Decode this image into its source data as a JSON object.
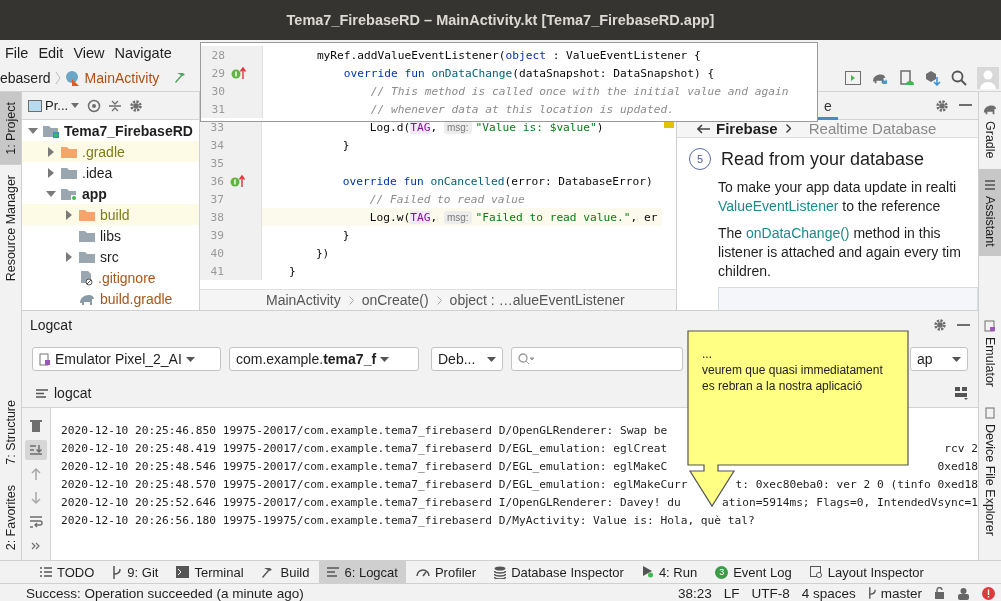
{
  "window": {
    "title": "Tema7_FirebaseRD – MainActivity.kt [Tema7_FirebaseRD.app]"
  },
  "menu": [
    "File",
    "Edit",
    "View",
    "Navigate"
  ],
  "navbar": {
    "crumbs": [
      "ebaserd",
      "MainActivity"
    ]
  },
  "left_strip": {
    "top": [
      {
        "label": "1: Project",
        "selected": true
      },
      {
        "label": "Resource Manager",
        "selected": false
      }
    ],
    "bottom": [
      {
        "label": "7: Structure",
        "selected": false
      },
      {
        "label": "2: Favorites",
        "selected": false
      }
    ]
  },
  "right_strip": {
    "top": [
      {
        "label": "Gradle",
        "kind": "gradle",
        "selected": false
      },
      {
        "label": "Assistant",
        "kind": "assistant",
        "selected": true
      }
    ],
    "bottom": [
      {
        "label": "Emulator",
        "kind": "emulator",
        "selected": false
      },
      {
        "label": "Device File Explorer",
        "kind": "device",
        "selected": false
      }
    ]
  },
  "project": {
    "title": "Pr...",
    "tree": [
      {
        "name": "Tema7_FirebaseRD",
        "kind": "module",
        "expanded": true,
        "children": [
          {
            "name": ".gradle",
            "kind": "folder",
            "excluded": true,
            "expanded": false
          },
          {
            "name": ".idea",
            "kind": "folder",
            "excluded": false,
            "expanded": false
          },
          {
            "name": "app",
            "kind": "module",
            "expanded": true,
            "children": [
              {
                "name": "build",
                "kind": "folder",
                "excluded": true,
                "expanded": false
              },
              {
                "name": "libs",
                "kind": "folder",
                "excluded": false
              },
              {
                "name": "src",
                "kind": "folder",
                "excluded": false,
                "expanded": false
              },
              {
                "name": ".gitignore",
                "kind": "file",
                "untracked": true
              },
              {
                "name": "build.gradle",
                "kind": "gradle",
                "untracked": true
              }
            ]
          }
        ]
      }
    ]
  },
  "editor": {
    "popup_lines": [
      {
        "number": "28",
        "marker": false,
        "current": false,
        "tokens": [
          {
            "kind": "p",
            "text": "        myRef.addValueEventListener("
          },
          {
            "kind": "kw",
            "text": "object"
          },
          {
            "kind": "p",
            "text": " : ValueEventListener {"
          }
        ]
      },
      {
        "number": "29",
        "marker": true,
        "current": false,
        "tokens": [
          {
            "kind": "kw",
            "text": "            override fun "
          },
          {
            "kind": "fn",
            "text": "onDataChange"
          },
          {
            "kind": "p",
            "text": "(dataSnapshot: DataSnapshot) {"
          }
        ]
      },
      {
        "number": "30",
        "marker": false,
        "current": false,
        "tokens": [
          {
            "kind": "cm",
            "text": "                // This method is called once with the initial value and again"
          }
        ]
      },
      {
        "number": "31",
        "marker": false,
        "current": false,
        "tokens": [
          {
            "kind": "cm",
            "text": "                // whenever data at this location is updated."
          }
        ]
      }
    ],
    "lines": [
      {
        "number": "33",
        "marker": false,
        "current": false,
        "tokens": [
          {
            "kind": "p",
            "text": "                Log.d("
          },
          {
            "kind": "tag",
            "text": "TAG"
          },
          {
            "kind": "p",
            "text": ", "
          },
          {
            "kind": "hint",
            "text": "msg:"
          },
          {
            "kind": "str",
            "text": "\"Value is: $value\""
          },
          {
            "kind": "p",
            "text": ")"
          }
        ]
      },
      {
        "number": "34",
        "marker": false,
        "current": false,
        "tokens": [
          {
            "kind": "p",
            "text": "            }"
          }
        ]
      },
      {
        "number": "35",
        "marker": false,
        "current": false
      },
      {
        "number": "36",
        "marker": true,
        "current": false,
        "tokens": [
          {
            "kind": "kw",
            "text": "            override fun "
          },
          {
            "kind": "fn",
            "text": "onCancelled"
          },
          {
            "kind": "p",
            "text": "(error: DatabaseError)"
          }
        ]
      },
      {
        "number": "37",
        "marker": false,
        "current": false,
        "tokens": [
          {
            "kind": "cm",
            "text": "                // Failed to read value"
          }
        ]
      },
      {
        "number": "38",
        "marker": false,
        "current": true,
        "tokens": [
          {
            "kind": "p",
            "text": "                Log.w("
          },
          {
            "kind": "tag",
            "text": "TAG"
          },
          {
            "kind": "p",
            "text": ", "
          },
          {
            "kind": "hint",
            "text": "msg:"
          },
          {
            "kind": "str",
            "text": "\"Failed to read value.\""
          },
          {
            "kind": "p",
            "text": ", er"
          }
        ]
      },
      {
        "number": "39",
        "marker": false,
        "current": false,
        "tokens": [
          {
            "kind": "p",
            "text": "            }"
          }
        ]
      },
      {
        "number": "40",
        "marker": false,
        "current": false,
        "tokens": [
          {
            "kind": "p",
            "text": "        })"
          }
        ]
      },
      {
        "number": "41",
        "marker": false,
        "current": false,
        "tokens": [
          {
            "kind": "p",
            "text": "    }"
          }
        ]
      }
    ],
    "breadcrumb": [
      "MainActivity",
      "onCreate()",
      "object : …alueEventListener"
    ]
  },
  "assistant": {
    "tab": "e",
    "back": "Firebase",
    "current": "Realtime Database",
    "step": "5",
    "heading": "Read from your database",
    "paragraphs": [
      [
        [
          {
            "kind": "plain",
            "text": "To make your app data update in realti"
          }
        ],
        [
          {
            "kind": "link",
            "text": "ValueEventListener"
          },
          {
            "kind": "plain",
            "text": " to the reference"
          }
        ]
      ],
      [
        [
          {
            "kind": "plain",
            "text": "The "
          },
          {
            "kind": "link",
            "text": "onDataChange()"
          },
          {
            "kind": "plain",
            "text": " method in this"
          }
        ],
        [
          {
            "kind": "plain",
            "text": "listener is attached and again every tim"
          }
        ],
        [
          {
            "kind": "plain",
            "text": "children."
          }
        ]
      ]
    ]
  },
  "logcat": {
    "title": "Logcat",
    "device": "Emulator Pixel_2_AI",
    "package": "com.example.**tema7_f**",
    "level": "Deb...",
    "filter": "ap",
    "tab": "logcat",
    "tools": [
      {
        "kind": "clear",
        "selected": false
      },
      {
        "kind": "scroll",
        "selected": true
      },
      {
        "kind": "up",
        "selected": false
      },
      {
        "kind": "down",
        "selected": false
      },
      {
        "kind": "wrap",
        "selected": false
      },
      {
        "kind": "more",
        "selected": false
      }
    ],
    "lines": [
      {
        "left": "2020-12-10 20:25:46.850 19975-20017/com.example.tema7_firebaserd D/OpenGLRenderer: Swap be"
      },
      {
        "left": "2020-12-10 20:25:48.419 19975-20017/com.example.tema7_firebaserd D/EGL_emulation: eglCreat",
        "right": "rcv 2"
      },
      {
        "left": "2020-12-10 20:25:48.546 19975-20017/com.example.tema7_firebaserd D/EGL_emulation: eglMakeC",
        "right": "0xed18"
      },
      {
        "left": "2020-12-10 20:25:48.570 19975-20017/com.example.tema7_firebaserd D/EGL_emulation: eglMakeCurr",
        "right": "t: 0xec80eba0: ver 2 0 (tinfo 0xed18"
      },
      {
        "left": "2020-12-10 20:25:52.646 19975-20017/com.example.tema7_firebaserd I/OpenGLRenderer: Davey! du",
        "right": "ation=5914ms; Flags=0, IntendedVsync=1"
      },
      {
        "left": "2020-12-10 20:26:56.180 19975-19975/com.example.tema7_firebaserd D/MyActivity: Value is: Hola, què tal?"
      }
    ]
  },
  "callout": {
    "lines": [
      "...",
      "veurem que quasi immediatament",
      "es rebran a la nostra aplicació"
    ]
  },
  "tool_tabs": [
    {
      "label": "TODO",
      "kind": "todo",
      "selected": false
    },
    {
      "label": "9: Git",
      "kind": "git",
      "selected": false
    },
    {
      "label": "Terminal",
      "kind": "terminal",
      "selected": false
    },
    {
      "label": "Build",
      "kind": "build",
      "selected": false
    },
    {
      "label": "6: Logcat",
      "kind": "logcat",
      "selected": true
    },
    {
      "label": "Profiler",
      "kind": "profiler",
      "selected": false
    },
    {
      "label": "Database Inspector",
      "kind": "database",
      "selected": false
    },
    {
      "label": "4: Run",
      "kind": "run",
      "selected": false
    },
    {
      "label": "Event Log",
      "kind": "events",
      "badge": "3",
      "selected": false
    },
    {
      "label": "Layout Inspector",
      "kind": "layout",
      "selected": false
    }
  ],
  "status_bar": {
    "message": "Success: Operation succeeded (a minute ago)",
    "position": "38:23",
    "line_separator": "LF",
    "encoding": "UTF-8",
    "indent": "4 spaces",
    "branch": "master"
  }
}
